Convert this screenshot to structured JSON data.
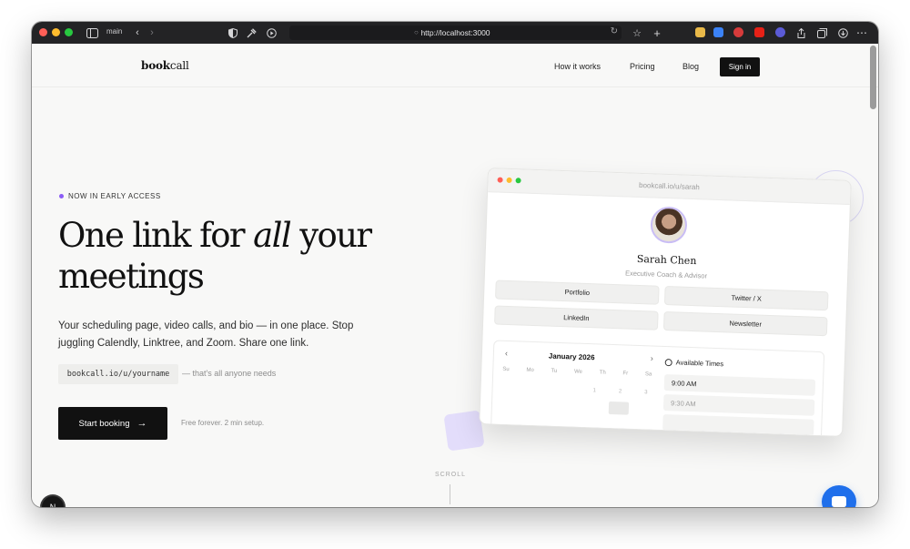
{
  "browser": {
    "tab_group_label": "main",
    "url": "http://localhost:3000"
  },
  "nav": {
    "logo_bold": "book",
    "logo_light": "call",
    "links": [
      "How it works",
      "Pricing",
      "Blog"
    ],
    "sign_in": "Sign in"
  },
  "hero": {
    "badge": "NOW IN EARLY ACCESS",
    "headline_part1": "One link for ",
    "headline_italic": "all",
    "headline_part2": " your",
    "headline_line2": "meetings",
    "subtext": "Your scheduling page, video calls, and bio — in one place. Stop juggling Calendly, Linktree, and Zoom. Share one link.",
    "code_chip": "bookcall.io/u/yourname",
    "code_note": "— that's all anyone needs",
    "cta_label": "Start booking",
    "cta_note": "Free forever. 2 min setup.",
    "scroll_label": "SCROLL"
  },
  "preview": {
    "url": "bookcall.io/u/sarah",
    "name": "Sarah Chen",
    "role": "Executive Coach & Advisor",
    "links": [
      "Portfolio",
      "Twitter / X",
      "LinkedIn",
      "Newsletter"
    ],
    "calendar": {
      "month": "January 2026",
      "weekdays": [
        "Su",
        "Mo",
        "Tu",
        "We",
        "Th",
        "Fr",
        "Sa"
      ],
      "dates": [
        "1",
        "2",
        "3"
      ]
    },
    "available_title": "Available Times",
    "slots": [
      "9:00 AM",
      "9:30 AM"
    ]
  },
  "dev": {
    "nextjs_badge": "N"
  },
  "colors": {
    "accent": "#8b5cf6",
    "chat_button": "#1f6feb",
    "primary_button": "#111111"
  }
}
